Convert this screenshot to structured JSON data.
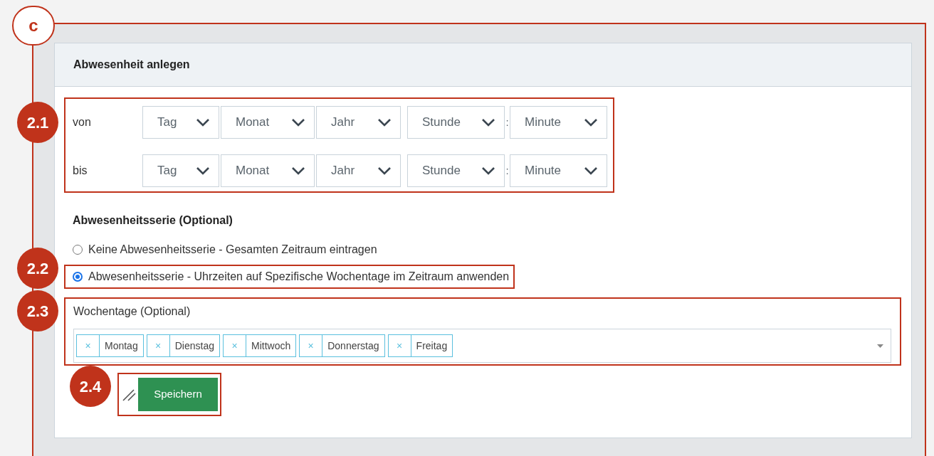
{
  "frame_label": "c",
  "markers": [
    {
      "label": "2.1"
    },
    {
      "label": "2.2"
    },
    {
      "label": "2.3"
    },
    {
      "label": "2.4"
    }
  ],
  "card": {
    "title": "Abwesenheit anlegen",
    "date_rows": [
      {
        "label": "von",
        "date_fields": [
          {
            "placeholder": "Tag"
          },
          {
            "placeholder": "Monat"
          },
          {
            "placeholder": "Jahr"
          }
        ],
        "hour": {
          "placeholder": "Stunde"
        },
        "separator": ":",
        "minute": {
          "placeholder": "Minute"
        }
      },
      {
        "label": "bis",
        "date_fields": [
          {
            "placeholder": "Tag"
          },
          {
            "placeholder": "Monat"
          },
          {
            "placeholder": "Jahr"
          }
        ],
        "hour": {
          "placeholder": "Stunde"
        },
        "separator": ":",
        "minute": {
          "placeholder": "Minute"
        }
      }
    ],
    "series": {
      "heading": "Abwesenheitsserie (Optional)",
      "options": [
        {
          "label": "Keine Abwesenheitsserie - Gesamten Zeitraum eintragen",
          "selected": false
        },
        {
          "label": "Abwesenheitsserie - Uhrzeiten auf Spezifische Wochentage im Zeitraum anwenden",
          "selected": true
        }
      ]
    },
    "weekdays": {
      "label": "Wochentage (Optional)",
      "tags": [
        {
          "remove": "×",
          "label": "Montag"
        },
        {
          "remove": "×",
          "label": "Dienstag"
        },
        {
          "remove": "×",
          "label": "Mittwoch"
        },
        {
          "remove": "×",
          "label": "Donnerstag"
        },
        {
          "remove": "×",
          "label": "Freitag"
        }
      ]
    },
    "save_button": "Speichern"
  }
}
